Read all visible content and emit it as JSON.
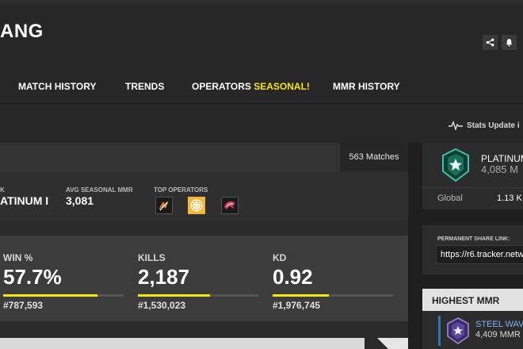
{
  "header": {
    "player_name": "ANG",
    "share_icon": "share-icon",
    "notify_icon": "bell-icon"
  },
  "nav": {
    "items": [
      {
        "label": "MATCH HISTORY"
      },
      {
        "label": "TRENDS"
      },
      {
        "label": "OPERATORS",
        "highlight": "SEASONAL!"
      },
      {
        "label": "MMR HISTORY"
      }
    ]
  },
  "stats_update": {
    "icon": "pulse-icon",
    "text": "Stats Update i"
  },
  "season": {
    "matches": "563 Matches",
    "rank_label": "K",
    "rank_value": "ATINUM I",
    "avg_mmr_label": "AVG SEASONAL MMR",
    "avg_mmr_value": "3,081",
    "top_ops_label": "TOP OPERATORS",
    "top_operators": [
      "operator-1-icon",
      "operator-2-icon",
      "operator-3-icon"
    ],
    "stats": [
      {
        "label": "WIN %",
        "value": "57.7%",
        "rank": "#787,593",
        "bar_fraction": 0.78
      },
      {
        "label": "KILLS",
        "value": "2,187",
        "rank": "#1,530,023",
        "bar_fraction": 0.6
      },
      {
        "label": "KD",
        "value": "0.92",
        "rank": "#1,976,745",
        "bar_fraction": 0.47
      }
    ]
  },
  "rank_card": {
    "icon": "platinum-rank-icon",
    "rank_name": "PLATINUM",
    "mmr": "4,085 M",
    "global_label": "Global",
    "global_value": "1.13 K"
  },
  "share": {
    "label": "PERMANENT SHARE LINK:",
    "value": "https://r6.tracker.netw"
  },
  "highest": {
    "title": "HIGHEST MMR",
    "icon": "steel-wave-rank-icon",
    "rank": "STEEL WAV",
    "mmr": "4,409 MMR"
  },
  "colors": {
    "accent": "#f6e70a",
    "background": "#1f1f1f",
    "link_blue": "#7fb3ec"
  }
}
